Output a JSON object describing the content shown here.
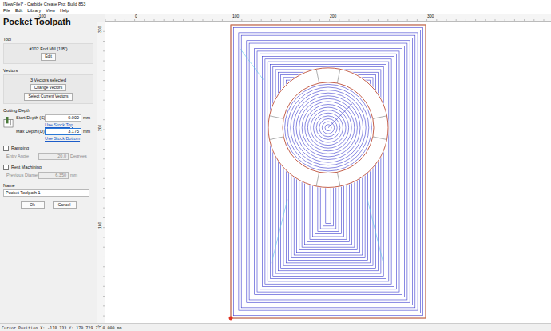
{
  "window": {
    "title": "[NewFile]* - Carbide Create Pro: Build 853"
  },
  "menu": [
    "File",
    "Edit",
    "Library",
    "View",
    "Help"
  ],
  "panel": {
    "title": "Pocket Toolpath",
    "tool": {
      "label": "Tool",
      "name": "#102 End Mill (1/8\")",
      "button": "Edit"
    },
    "vectors": {
      "label": "Vectors",
      "summary": "3 Vectors selected",
      "buttons": [
        "Change Vectors",
        "Select Current Vectors"
      ]
    },
    "cutting_depth": {
      "label": "Cutting Depth",
      "fields": [
        {
          "label": "Start Depth (S)",
          "value": "0.000",
          "unit": "mm",
          "link": "Use Stock Top",
          "focused": false
        },
        {
          "label": "Max Depth (D)",
          "value": "3.175",
          "unit": "mm",
          "link": "Use Stock Bottom",
          "focused": true
        }
      ]
    },
    "options": [
      {
        "label": "Ramping",
        "checked": false,
        "field": {
          "label": "Entry Angle",
          "value": "20.0",
          "unit": "Degrees",
          "disabled": true
        }
      },
      {
        "label": "Rest Machining",
        "checked": false,
        "field": {
          "label": "Previous Diameter",
          "value": "6.350",
          "unit": "mm",
          "disabled": true
        }
      }
    ],
    "name": {
      "label": "Name",
      "value": "Pocket Toolpath 1"
    },
    "buttons": [
      "Ok",
      "Cancel"
    ]
  },
  "rulers": {
    "top": [
      "-100",
      "0",
      "100",
      "200",
      "300"
    ],
    "left": [
      "300",
      "200",
      "100",
      "0"
    ]
  },
  "status_bar": "Cursor Position X: -118.333 Y: 170.729 Z: 0.000 mm"
}
